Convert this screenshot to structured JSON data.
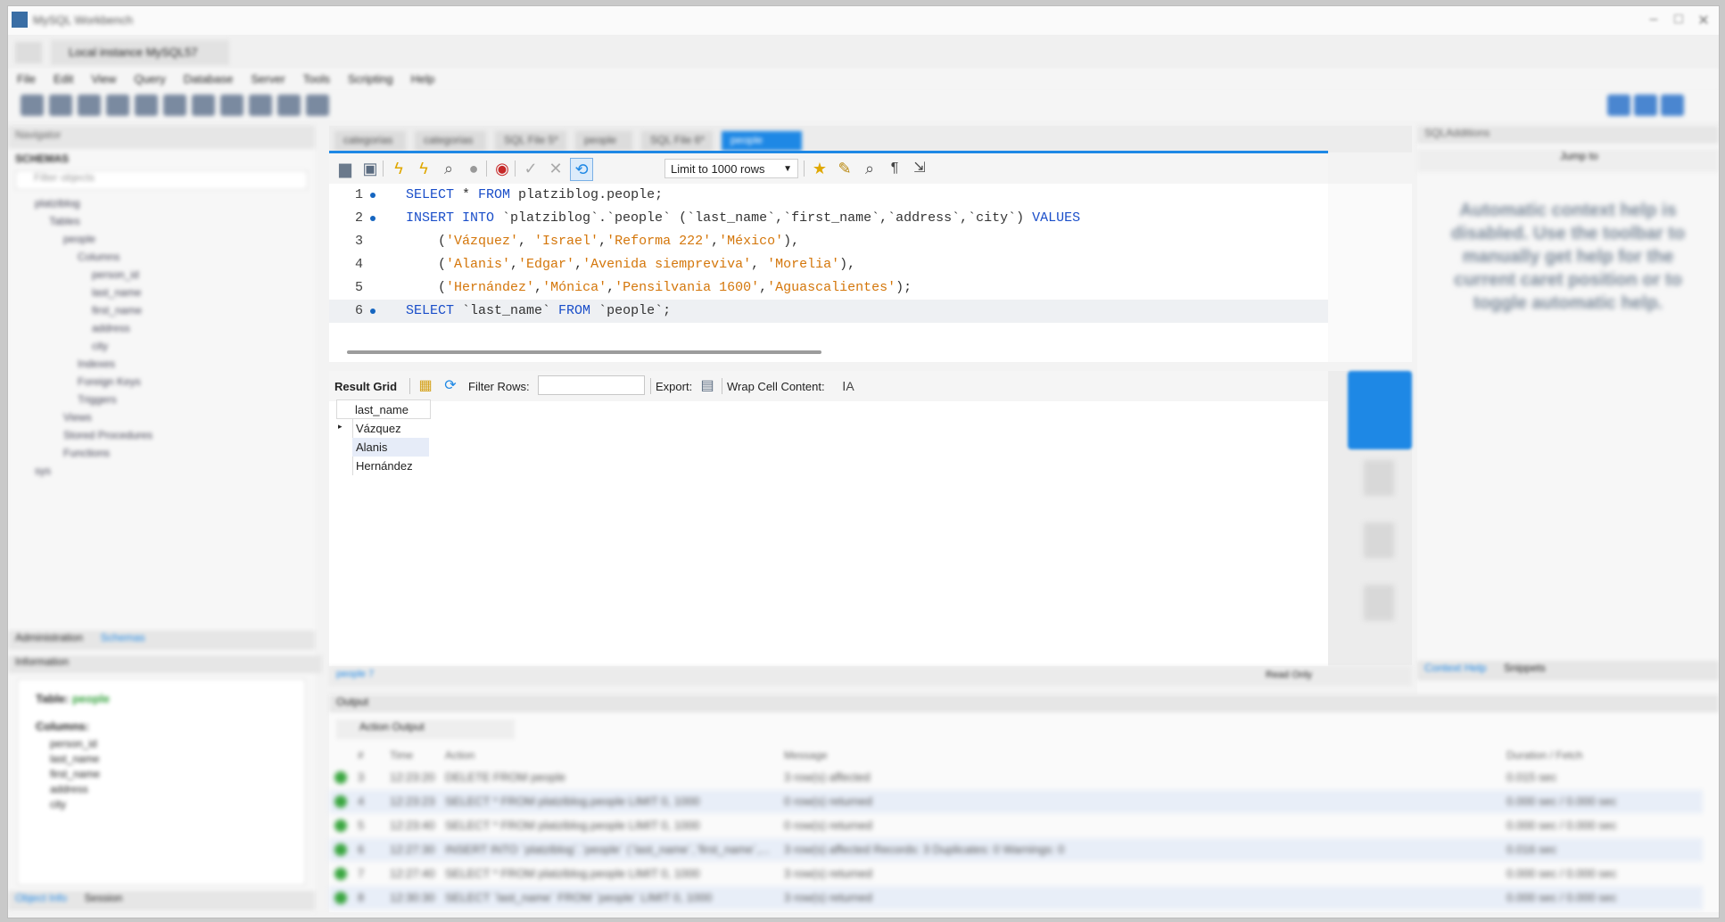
{
  "window": {
    "title": "MySQL Workbench",
    "connection_tab": "Local instance MySQL57"
  },
  "menu": [
    "File",
    "Edit",
    "View",
    "Query",
    "Database",
    "Server",
    "Tools",
    "Scripting",
    "Help"
  ],
  "navigator": {
    "header": "Navigator",
    "schemas_label": "SCHEMAS",
    "filter_placeholder": "Filter objects",
    "tree": [
      "platziblog",
      "Tables",
      "people",
      "Columns",
      "person_id",
      "last_name",
      "first_name",
      "address",
      "city",
      "Indexes",
      "Foreign Keys",
      "Triggers",
      "Views",
      "Stored Procedures",
      "Functions",
      "sys"
    ],
    "bottom_tabs": [
      "Administration",
      "Schemas"
    ],
    "info_header": "Information",
    "info_table_label": "Table:",
    "info_table_name": "people",
    "info_columns_label": "Columns:",
    "info_columns": [
      "person_id",
      "last_name",
      "first_name",
      "address",
      "city"
    ],
    "footer_tabs": [
      "Object Info",
      "Session"
    ]
  },
  "editor_tabs": [
    "categorias",
    "categorias",
    "SQL File 5*",
    "people",
    "SQL File 6*",
    "people"
  ],
  "sql_toolbar": {
    "limit": "Limit to 1000 rows"
  },
  "editor": {
    "lines": [
      {
        "n": "1",
        "segments": [
          {
            "c": "kw",
            "t": "SELECT"
          },
          {
            "c": "id",
            "t": " * "
          },
          {
            "c": "kw",
            "t": "FROM"
          },
          {
            "c": "id",
            "t": " platziblog.people;"
          }
        ]
      },
      {
        "n": "2",
        "segments": [
          {
            "c": "kw",
            "t": "INSERT INTO"
          },
          {
            "c": "id",
            "t": " `platziblog`.`people` (`last_name`,`first_name`,`address`,`city`) "
          },
          {
            "c": "kw",
            "t": "VALUES"
          }
        ]
      },
      {
        "n": "3",
        "segments": [
          {
            "c": "id",
            "t": "    ("
          },
          {
            "c": "st",
            "t": "'Vázquez'"
          },
          {
            "c": "id",
            "t": ", "
          },
          {
            "c": "st",
            "t": "'Israel'"
          },
          {
            "c": "id",
            "t": ","
          },
          {
            "c": "st",
            "t": "'Reforma 222'"
          },
          {
            "c": "id",
            "t": ","
          },
          {
            "c": "st",
            "t": "'México'"
          },
          {
            "c": "id",
            "t": "),"
          }
        ]
      },
      {
        "n": "4",
        "segments": [
          {
            "c": "id",
            "t": "    ("
          },
          {
            "c": "st",
            "t": "'Alanis'"
          },
          {
            "c": "id",
            "t": ","
          },
          {
            "c": "st",
            "t": "'Edgar'"
          },
          {
            "c": "id",
            "t": ","
          },
          {
            "c": "st",
            "t": "'Avenida siempreviva'"
          },
          {
            "c": "id",
            "t": ", "
          },
          {
            "c": "st",
            "t": "'Morelia'"
          },
          {
            "c": "id",
            "t": "),"
          }
        ]
      },
      {
        "n": "5",
        "segments": [
          {
            "c": "id",
            "t": "    ("
          },
          {
            "c": "st",
            "t": "'Hernández'"
          },
          {
            "c": "id",
            "t": ","
          },
          {
            "c": "st",
            "t": "'Mónica'"
          },
          {
            "c": "id",
            "t": ","
          },
          {
            "c": "st",
            "t": "'Pensilvania 1600'"
          },
          {
            "c": "id",
            "t": ","
          },
          {
            "c": "st",
            "t": "'Aguascalientes'"
          },
          {
            "c": "id",
            "t": ");"
          }
        ]
      },
      {
        "n": "6",
        "segments": [
          {
            "c": "kw",
            "t": "SELECT"
          },
          {
            "c": "id",
            "t": " `last_name` "
          },
          {
            "c": "kw",
            "t": "FROM"
          },
          {
            "c": "id",
            "t": " `people`;"
          }
        ]
      }
    ]
  },
  "result_toolbar": {
    "result_grid": "Result Grid",
    "filter_rows": "Filter Rows:",
    "export": "Export:",
    "wrap": "Wrap Cell Content:"
  },
  "result_grid": {
    "column": "last_name",
    "rows": [
      "Vázquez",
      "Alanis",
      "Hernández"
    ]
  },
  "context_help": {
    "header": "SQLAdditions",
    "jump_to": "Jump to",
    "message": "Automatic context help is disabled. Use the toolbar to manually get help for the current caret position or to toggle automatic help.",
    "tabs": [
      "Context Help",
      "Snippets"
    ]
  },
  "output": {
    "header": "Output",
    "selector": "Action Output",
    "columns": [
      "#",
      "Time",
      "Action",
      "Message",
      "Duration / Fetch"
    ],
    "rows": [
      {
        "n": "3",
        "time": "12:23:20",
        "action": "DELETE FROM people",
        "message": "3 row(s) affected",
        "dur": "0.015 sec"
      },
      {
        "n": "4",
        "time": "12:23:23",
        "action": "SELECT * FROM platziblog.people LIMIT 0, 1000",
        "message": "0 row(s) returned",
        "dur": "0.000 sec / 0.000 sec"
      },
      {
        "n": "5",
        "time": "12:23:40",
        "action": "SELECT * FROM platziblog.people LIMIT 0, 1000",
        "message": "0 row(s) returned",
        "dur": "0.000 sec / 0.000 sec"
      },
      {
        "n": "6",
        "time": "12:27:30",
        "action": "INSERT INTO `platziblog`.`people` (`last_name`,`first_name`,...",
        "message": "3 row(s) affected Records: 3  Duplicates: 0  Warnings: 0",
        "dur": "0.016 sec"
      },
      {
        "n": "7",
        "time": "12:27:40",
        "action": "SELECT * FROM platziblog.people LIMIT 0, 1000",
        "message": "3 row(s) returned",
        "dur": "0.000 sec / 0.000 sec"
      },
      {
        "n": "8",
        "time": "12:30:30",
        "action": "SELECT `last_name` FROM `people` LIMIT 0, 1000",
        "message": "3 row(s) returned",
        "dur": "0.000 sec / 0.000 sec"
      }
    ]
  },
  "editor_status": {
    "tab": "people 7",
    "read_only": "Read Only"
  }
}
